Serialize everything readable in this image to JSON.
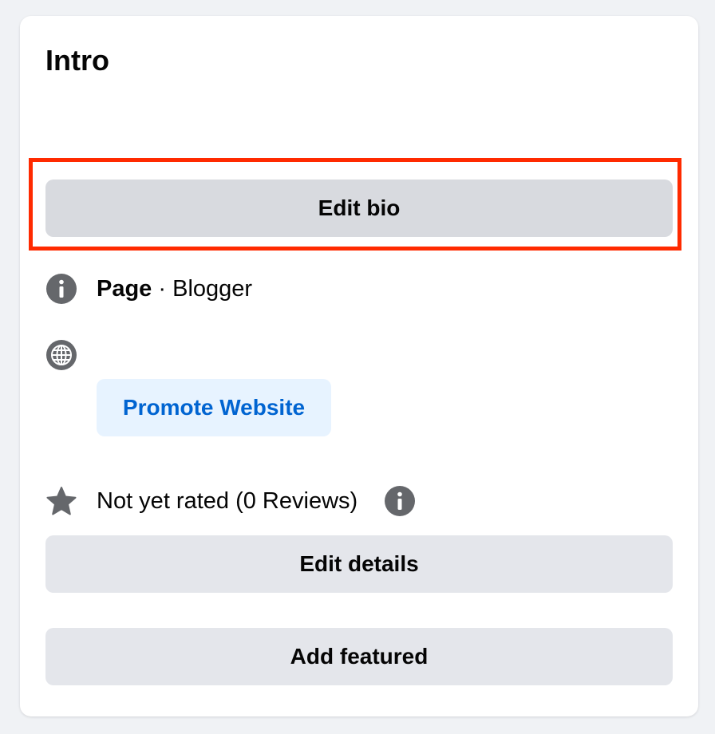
{
  "intro": {
    "title": "Intro",
    "edit_bio_label": "Edit bio",
    "category": {
      "icon": "info-icon",
      "type_label": "Page",
      "separator": "·",
      "category_label": "Blogger"
    },
    "website": {
      "icon": "globe-icon",
      "promote_label": "Promote Website"
    },
    "rating": {
      "icon": "star-icon",
      "text": "Not yet rated (0 Reviews)",
      "info_icon": "info-icon"
    },
    "edit_details_label": "Edit details",
    "add_featured_label": "Add featured"
  },
  "colors": {
    "highlight": "#ff2a00",
    "link_blue": "#0064d1",
    "button_gray": "#e4e6eb",
    "icon_gray": "#65676b"
  }
}
